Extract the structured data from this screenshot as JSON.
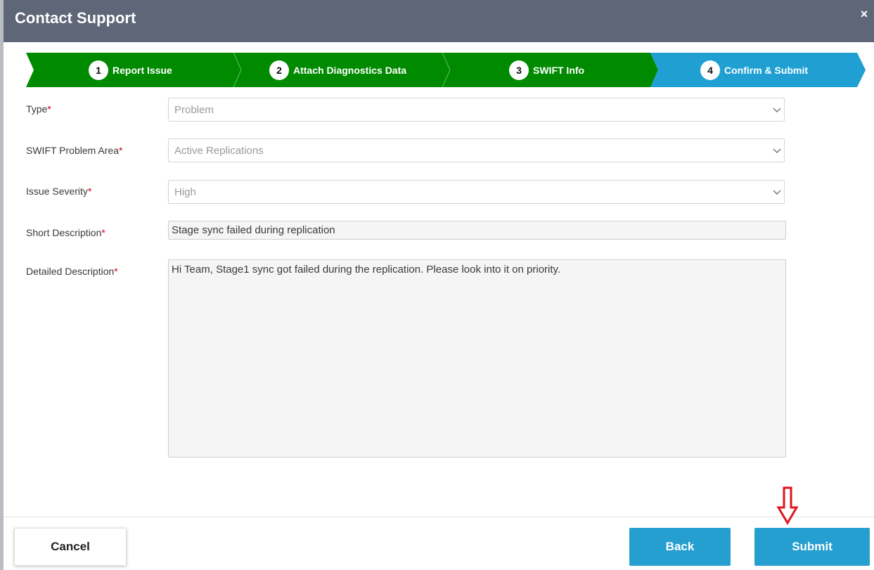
{
  "dialog": {
    "title": "Contact Support",
    "close_symbol": "×"
  },
  "steps": [
    {
      "number": "1",
      "label": "Report Issue",
      "state": "done"
    },
    {
      "number": "2",
      "label": "Attach Diagnostics Data",
      "state": "done"
    },
    {
      "number": "3",
      "label": "SWIFT Info",
      "state": "done"
    },
    {
      "number": "4",
      "label": "Confirm & Submit",
      "state": "active"
    }
  ],
  "form": {
    "required_marker": "*",
    "type": {
      "label": "Type",
      "value": "Problem"
    },
    "problem_area": {
      "label": "SWIFT Problem Area",
      "value": "Active Replications"
    },
    "severity": {
      "label": "Issue Severity",
      "value": "High"
    },
    "short_description": {
      "label": "Short Description",
      "value": "Stage sync failed during replication"
    },
    "detailed_description": {
      "label": "Detailed Description",
      "value": "Hi Team, Stage1 sync got failed during the replication. Please look into it on priority."
    }
  },
  "buttons": {
    "cancel": "Cancel",
    "back": "Back",
    "submit": "Submit"
  },
  "colors": {
    "header": "#5f6678",
    "step_done": "#008a00",
    "step_active": "#1f9fd2",
    "primary_button": "#259fd0",
    "annotation_arrow": "#e0141e"
  },
  "icons": {
    "close": "close-icon",
    "dropdown": "chevron-down-icon",
    "annotation": "arrow-down-icon"
  }
}
